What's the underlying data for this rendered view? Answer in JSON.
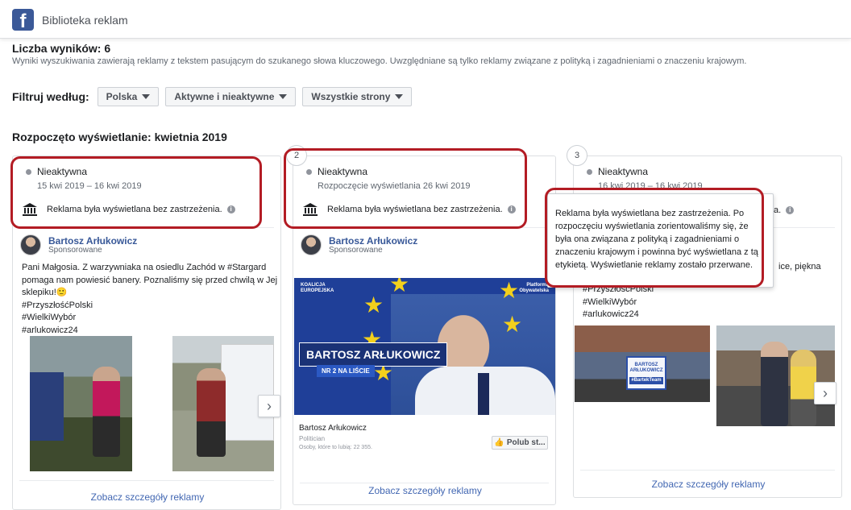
{
  "header": {
    "app_title": "Biblioteka reklam",
    "logo_letter": "f"
  },
  "results": {
    "title": "Liczba wyników: 6",
    "description": "Wyniki wyszukiwania zawierają reklamy z tekstem pasującym do szukanego słowa kluczowego. Uwzględniane są tylko reklamy związane z polityką i zagadnieniami o znaczeniu krajowym."
  },
  "filters": {
    "label": "Filtruj według:",
    "country": "Polska",
    "status": "Aktywne i nieaktywne",
    "pages": "Wszystkie strony"
  },
  "section_title": "Rozpoczęto wyświetlanie: kwietnia 2019",
  "cards": [
    {
      "status": "Nieaktywna",
      "dates": "15 kwi 2019 – 16 kwi 2019",
      "disclaimer": "Reklama była wyświetlana bez zastrzeżenia.",
      "advertiser": "Bartosz Arłukowicz",
      "sponsored": "Sponsorowane",
      "text": "Pani Małgosia. Z warzywniaka na osiedlu Zachód w #Stargard pomaga nam powiesić banery. Poznaliśmy się przed chwilą w Jej sklepiku!🙂\n#PrzyszłośćPolski\n#WielkiWybór\n#arlukowicz24",
      "see_details": "Zobacz szczegóły reklamy"
    },
    {
      "badge": "2",
      "status": "Nieaktywna",
      "dates": "Rozpoczęcie wyświetlania 26 kwi 2019",
      "disclaimer": "Reklama była wyświetlana bez zastrzeżenia.",
      "advertiser": "Bartosz Arłukowicz",
      "sponsored": "Sponsorowane",
      "banner_name": "BARTOSZ ARŁUKOWICZ",
      "banner_nr": "NR 2 NA LIŚCIE",
      "banner_left_logo": "KOALICJA EUROPEJSKA",
      "banner_right_logo": "Platforma Obywatelska",
      "page_name": "Bartosz Arłukowicz",
      "page_category": "Politician",
      "page_likes": "Osoby, które to lubią: 22 355.",
      "like_button": "Polub st...",
      "see_details": "Zobacz szczegóły reklamy"
    },
    {
      "badge": "3",
      "status": "Nieaktywna",
      "dates": "16 kwi 2019 – 16 kwi 2019",
      "disclaimer_tail": "a.",
      "text_tail1": "ice, piękna",
      "text": "#PrzyszłośćPolski\n#WielkiWybór\n#arlukowicz24",
      "photo_sign": "BARTOSZ ARŁUKOWICZ",
      "photo_tag": "#BartekTeam",
      "see_details": "Zobacz szczegóły reklamy"
    }
  ],
  "tooltip": "Reklama była wyświetlana bez zastrzeżenia. Po rozpoczęciu wyświetlania zorientowaliśmy się, że była ona związana z polityką i zagadnieniami o znaczeniu krajowym i powinna być wyświetlana z tą etykietą. Wyświetlanie reklamy zostało przerwane.",
  "icons": {
    "status": "gray-dot-icon",
    "bank": "bank-building-icon",
    "info": "info-icon",
    "next": "chevron-right-icon",
    "like": "thumbs-up-icon"
  },
  "colors": {
    "brand": "#3b5998",
    "link": "#4267b2",
    "highlight": "#b31c24",
    "banner": "#1f3f98"
  }
}
